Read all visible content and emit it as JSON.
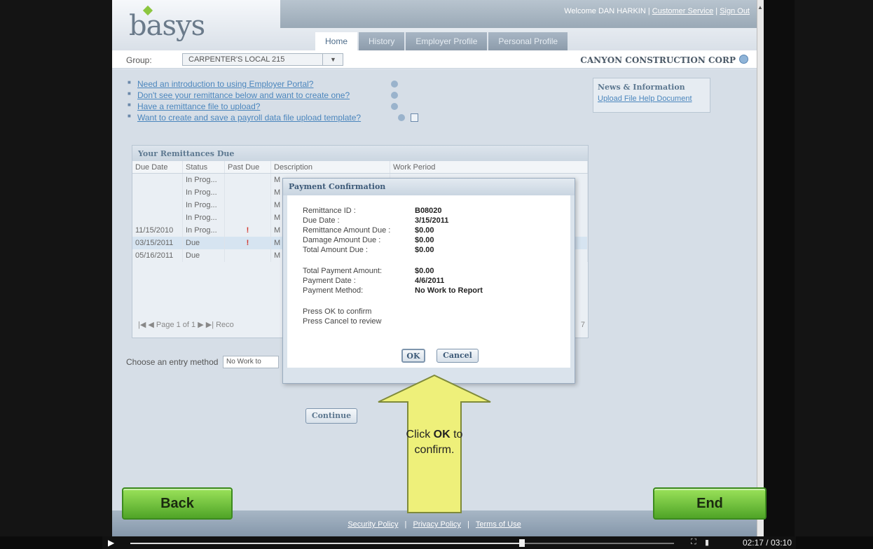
{
  "header": {
    "logo_text": "basys",
    "welcome": "Welcome DAN HARKIN |",
    "customer_service": "Customer Service",
    "sep": "|",
    "sign_out": "Sign Out",
    "tabs": [
      {
        "label": "Home"
      },
      {
        "label": "History"
      },
      {
        "label": "Employer Profile"
      },
      {
        "label": "Personal Profile"
      }
    ]
  },
  "groupbar": {
    "label": "Group:",
    "selected": "CARPENTER'S LOCAL 215",
    "company": "CANYON CONSTRUCTION CORP"
  },
  "links": [
    {
      "label": "Need an introduction to using Employer Portal?"
    },
    {
      "label": "Don't see your remittance below and want to create one?"
    },
    {
      "label": "Have a remittance file to upload?"
    },
    {
      "label": "Want to create and save a payroll data file upload template?"
    }
  ],
  "news": {
    "title": "News & Information",
    "link": "Upload File Help Document"
  },
  "remittances": {
    "title": "Your Remittances Due",
    "columns": [
      "Due Date",
      "Status",
      "Past Due",
      "Description",
      "Work Period"
    ],
    "rows": [
      {
        "due": "",
        "status": "In Prog...",
        "past": "",
        "desc": "M",
        "period": ""
      },
      {
        "due": "",
        "status": "In Prog...",
        "past": "",
        "desc": "M",
        "period": ""
      },
      {
        "due": "",
        "status": "In Prog...",
        "past": "",
        "desc": "M",
        "period": ""
      },
      {
        "due": "",
        "status": "In Prog...",
        "past": "",
        "desc": "M",
        "period": ""
      },
      {
        "due": "11/15/2010",
        "status": "In Prog...",
        "past": "!",
        "desc": "M",
        "period": ""
      },
      {
        "due": "03/15/2011",
        "status": "Due",
        "past": "!",
        "desc": "M",
        "period": ""
      },
      {
        "due": "05/16/2011",
        "status": "Due",
        "past": "",
        "desc": "M",
        "period": ""
      }
    ],
    "pager": "|◀ ◀ Page 1 of 1 ▶ ▶| Reco",
    "pager_right": "7"
  },
  "entry": {
    "label": "Choose an entry method",
    "selected": "No Work to"
  },
  "continue_label": "Continue",
  "dialog": {
    "title": "Payment Confirmation",
    "fields": [
      {
        "label": "Remittance ID :",
        "value": "B08020"
      },
      {
        "label": "Due Date :",
        "value": "3/15/2011"
      },
      {
        "label": "Remittance Amount Due :",
        "value": "$0.00"
      },
      {
        "label": "Damage Amount Due :",
        "value": "$0.00"
      },
      {
        "label": "Total Amount Due :",
        "value": "$0.00"
      },
      {
        "label": "Total Payment Amount:",
        "value": "$0.00"
      },
      {
        "label": "Payment Date :",
        "value": "4/6/2011"
      },
      {
        "label": "Payment Method:",
        "value": "No Work to Report"
      }
    ],
    "note1": "Press OK to confirm",
    "note2": "Press Cancel to review",
    "ok": "OK",
    "cancel": "Cancel"
  },
  "callout": {
    "pre": "Click ",
    "bold": "OK",
    "post": " to",
    "line2": "confirm."
  },
  "footer": {
    "security": "Security Policy",
    "privacy": "Privacy Policy",
    "terms": "Terms of Use",
    "sep": "|"
  },
  "nav": {
    "back": "Back",
    "end": "End"
  },
  "player": {
    "time": "02:17 / 03:10",
    "progress_fraction": 0.72
  },
  "colors": {
    "accent": "#4b86bd",
    "nav_green": "#4fa427",
    "callout_yellow": "#eef07a"
  }
}
